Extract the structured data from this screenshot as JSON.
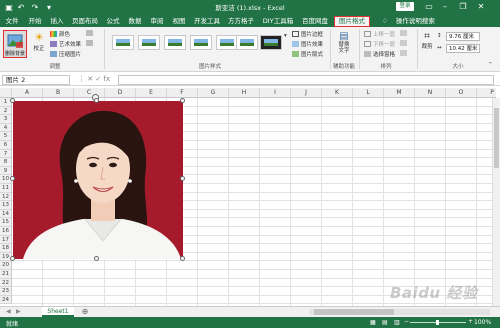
{
  "titlebar": {
    "doc_title": "斯亚洁 (1).xlsx  -  Excel",
    "login_label": "登录",
    "undo_icon": "undo-icon",
    "redo_icon": "redo-icon",
    "save_icon": "save-icon",
    "minimize": "–",
    "restore": "❐",
    "close": "✕"
  },
  "tabs": [
    {
      "label": "文件"
    },
    {
      "label": "开始"
    },
    {
      "label": "插入"
    },
    {
      "label": "页面布局"
    },
    {
      "label": "公式"
    },
    {
      "label": "数据"
    },
    {
      "label": "审阅"
    },
    {
      "label": "视图"
    },
    {
      "label": "开发工具"
    },
    {
      "label": "方方格子"
    },
    {
      "label": "DIY工具箱"
    },
    {
      "label": "百度网盘"
    },
    {
      "label": "图片格式",
      "active": true
    }
  ],
  "tell_me": "操作说明搜索",
  "ribbon": {
    "remove_bg": "删除背景",
    "correct": "校正",
    "color": "颜色",
    "artistic": "艺术效果",
    "compress": "压缩图片",
    "group_adjust": "调整",
    "group_styles": "图片样式",
    "border": "图片边框",
    "effects": "图片效果",
    "layout": "图片版式",
    "alt_text": "替换文字",
    "group_accessibility": "辅助功能",
    "bring_forward": "上移一层",
    "send_backward": "下移一层",
    "selection_pane": "选择窗格",
    "group_arrange": "排列",
    "crop": "裁剪",
    "height": "9.76 厘米",
    "width": "10.42 厘米",
    "group_size": "大小"
  },
  "formula_bar": {
    "name_box": "图片 2",
    "icons": "⋮  ✕  ✓  fx"
  },
  "columns": [
    "A",
    "B",
    "C",
    "D",
    "E",
    "F",
    "G",
    "H",
    "I",
    "J",
    "K",
    "L",
    "M",
    "N",
    "O",
    "P"
  ],
  "rows": [
    "1",
    "2",
    "3",
    "4",
    "5",
    "6",
    "7",
    "8",
    "9",
    "10",
    "11",
    "12",
    "13",
    "14",
    "15",
    "16",
    "17",
    "18",
    "19",
    "20",
    "21",
    "22",
    "23",
    "24"
  ],
  "sheet_tab": "Sheet1",
  "status": {
    "ready": "就绪",
    "zoom": "100%"
  },
  "watermark": "Baidu 经验",
  "colors": {
    "excel_green": "#217346",
    "photo_bg": "#a61b2c",
    "highlight": "#e03030"
  }
}
